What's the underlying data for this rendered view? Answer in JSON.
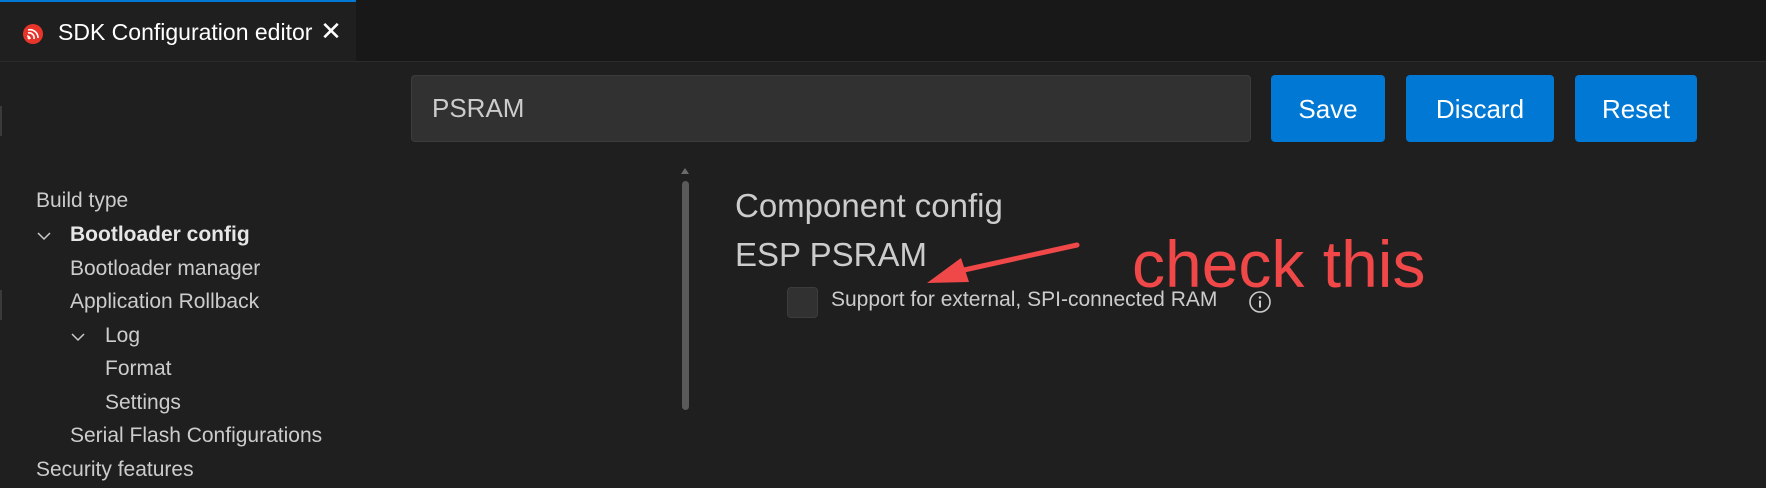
{
  "tab": {
    "title": "SDK Configuration editor",
    "icon": "espressif-logo-icon",
    "close_glyph": "✕",
    "accent_color": "#0078d4"
  },
  "toolbar": {
    "search_value": "PSRAM",
    "save_label": "Save",
    "discard_label": "Discard",
    "reset_label": "Reset"
  },
  "sidebar": {
    "items": [
      {
        "label": "Build type"
      },
      {
        "label": "Bootloader config"
      },
      {
        "label": "Bootloader manager"
      },
      {
        "label": "Application Rollback"
      },
      {
        "label": "Log"
      },
      {
        "label": "Format"
      },
      {
        "label": "Settings"
      },
      {
        "label": "Serial Flash Configurations"
      },
      {
        "label": "Security features"
      }
    ]
  },
  "main": {
    "section_title": "Component config",
    "subsection_title": "ESP PSRAM",
    "option_label": "Support for external, SPI-connected RAM",
    "option_checked": false
  },
  "annotation": {
    "text": "check this",
    "color": "#f04848"
  }
}
